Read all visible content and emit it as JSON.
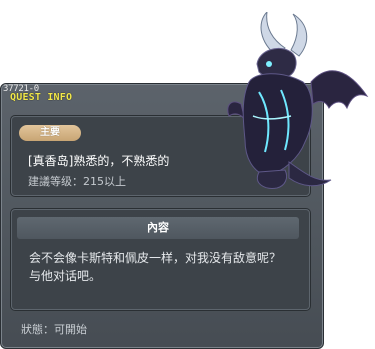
{
  "window": {
    "quest_id": "37721-0",
    "header": "QUEST INFO"
  },
  "quest": {
    "badge": "主要",
    "title": "[真香岛]熟悉的，不熟悉的",
    "level": "建議等级：215以上"
  },
  "content": {
    "header": "內容",
    "lines": [
      "会不会像卡斯特和佩皮一样，对我没有敌意呢？",
      "与他对话吧。"
    ]
  },
  "status": "狀態：可開始",
  "icons": {
    "npc": "dark-dragon-npc-icon"
  },
  "colors": {
    "header_text": "#f2e84a",
    "badge": "#d4b384",
    "window": "#555c63"
  }
}
